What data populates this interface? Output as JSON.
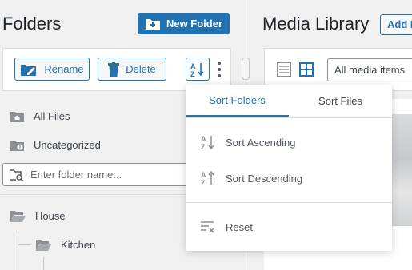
{
  "left": {
    "title": "Folders",
    "new_folder_label": "New Folder",
    "rename_label": "Rename",
    "delete_label": "Delete",
    "all_files": "All Files",
    "uncategorized": "Uncategorized",
    "search_placeholder": "Enter folder name...",
    "tree": [
      {
        "label": "House"
      },
      {
        "label": "Kitchen"
      }
    ]
  },
  "right": {
    "title": "Media Library",
    "add_new_label": "Add N",
    "filter_selected": "All media items"
  },
  "dropdown": {
    "tabs": [
      "Sort Folders",
      "Sort Files"
    ],
    "items": [
      "Sort Ascending",
      "Sort Descending",
      "Reset"
    ]
  },
  "colors": {
    "accent": "#2271b1",
    "background": "#f0f0f1",
    "text": "#3c434a"
  }
}
